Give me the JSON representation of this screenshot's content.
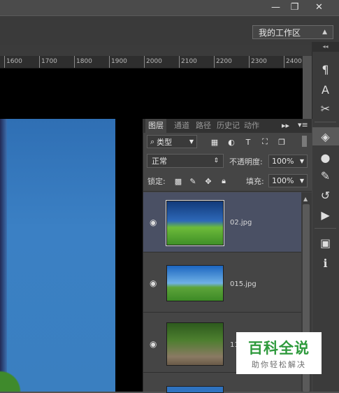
{
  "window": {
    "minimize_icon": "—",
    "restore_icon": "❐",
    "close_icon": "✕"
  },
  "options_bar": {
    "workspace": "我的工作区"
  },
  "ruler": {
    "ticks": [
      "1600",
      "1700",
      "1800",
      "1900",
      "2000",
      "2100",
      "2200",
      "2300",
      "2400"
    ]
  },
  "layers_panel": {
    "tabs": [
      "图层",
      "通道",
      "路径",
      "历史记",
      "动作"
    ],
    "filter_kind": "类型",
    "blend_mode": "正常",
    "opacity_label": "不透明度:",
    "opacity_value": "100%",
    "lock_label": "锁定:",
    "fill_label": "填充:",
    "fill_value": "100%",
    "layers": [
      {
        "name": "02.jpg",
        "selected": true
      },
      {
        "name": "015.jpg",
        "selected": false
      },
      {
        "name": "11",
        "selected": false
      }
    ]
  },
  "watermark": {
    "title": "百科全说",
    "subtitle": "助你轻松解决"
  },
  "colors": {
    "panel": "#454545",
    "selected_layer": "#4a5064",
    "watermark_green": "#2e9a3c"
  }
}
